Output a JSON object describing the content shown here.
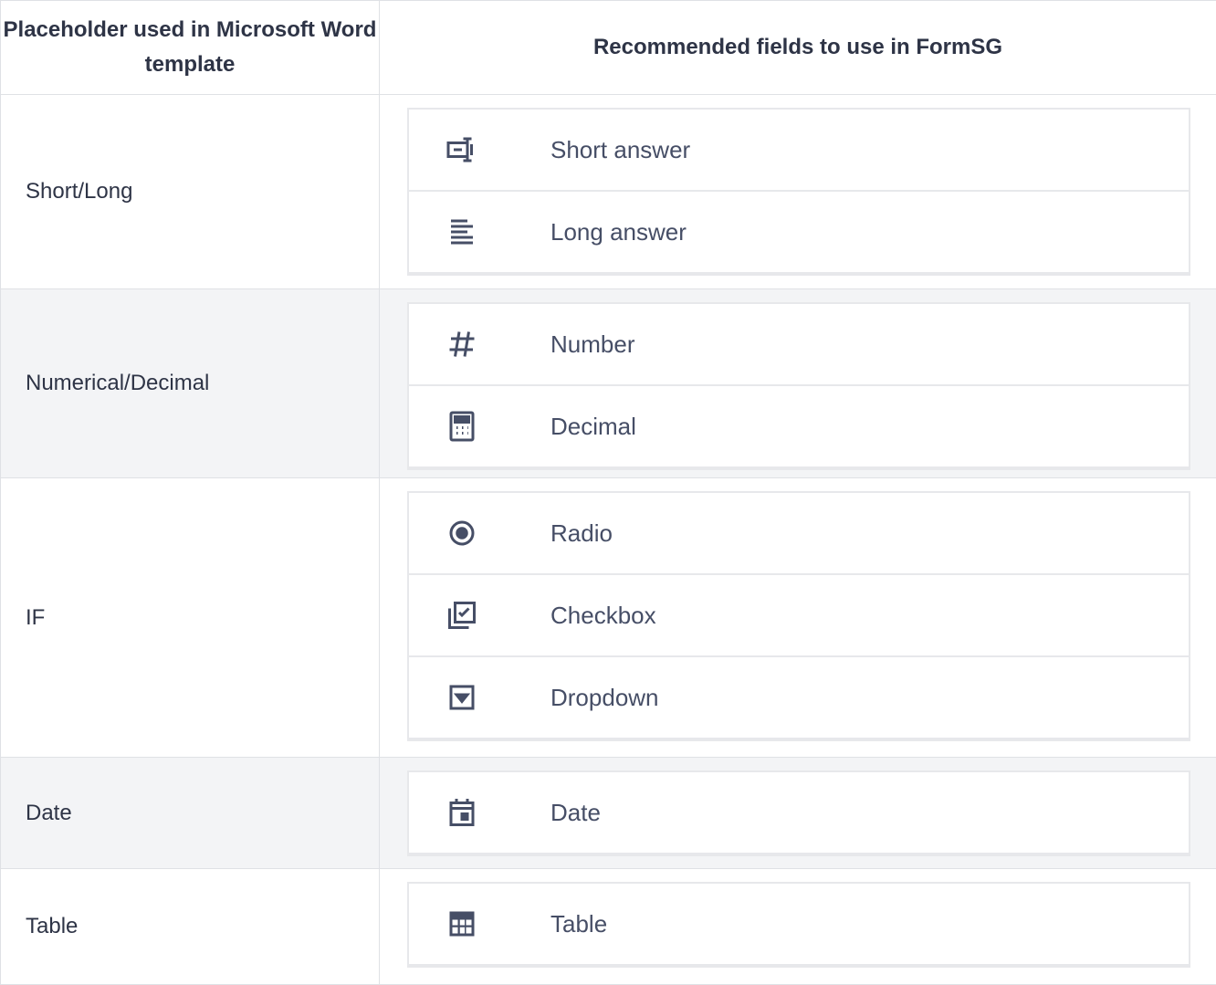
{
  "header": {
    "col1": "Placeholder used in Microsoft Word template",
    "col2": "Recommended fields to use in FormSG"
  },
  "rows": [
    {
      "placeholder": "Short/Long",
      "fields": [
        {
          "icon": "short-answer-icon",
          "label": "Short answer"
        },
        {
          "icon": "long-answer-icon",
          "label": "Long answer"
        }
      ]
    },
    {
      "placeholder": "Numerical/Decimal",
      "fields": [
        {
          "icon": "hash-icon",
          "label": "Number"
        },
        {
          "icon": "calculator-icon",
          "label": "Decimal"
        }
      ]
    },
    {
      "placeholder": "IF",
      "fields": [
        {
          "icon": "radio-icon",
          "label": "Radio"
        },
        {
          "icon": "checkbox-icon",
          "label": "Checkbox"
        },
        {
          "icon": "dropdown-icon",
          "label": "Dropdown"
        }
      ]
    },
    {
      "placeholder": "Date",
      "fields": [
        {
          "icon": "calendar-icon",
          "label": "Date"
        }
      ]
    },
    {
      "placeholder": "Table",
      "fields": [
        {
          "icon": "table-icon",
          "label": "Table"
        }
      ]
    }
  ],
  "colors": {
    "text": "#2e3446",
    "icon": "#464e66",
    "shade": "#f3f4f6",
    "border": "#dfe1e5"
  }
}
